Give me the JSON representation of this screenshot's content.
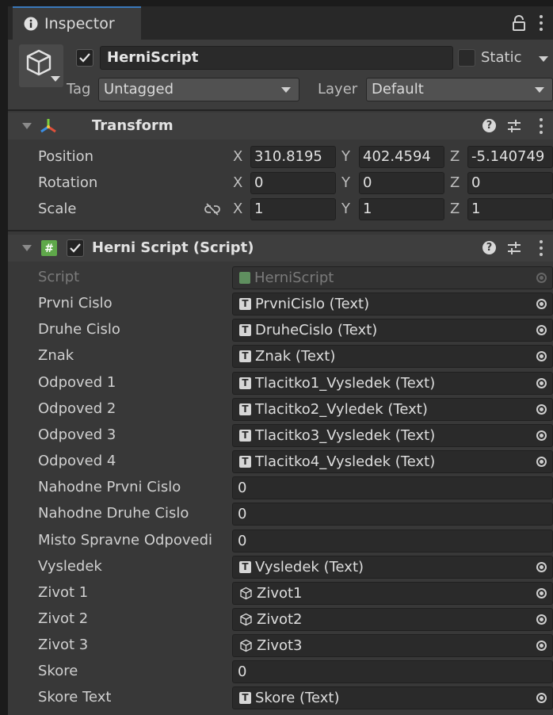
{
  "tab": {
    "label": "Inspector"
  },
  "header": {
    "object_name": "HerniScript",
    "static_label": "Static",
    "tag_label": "Tag",
    "tag_value": "Untagged",
    "layer_label": "Layer",
    "layer_value": "Default"
  },
  "transform": {
    "title": "Transform",
    "rows": [
      {
        "label": "Position",
        "x": "310.8195",
        "y": "402.4594",
        "z": "-5.140749"
      },
      {
        "label": "Rotation",
        "x": "0",
        "y": "0",
        "z": "0"
      },
      {
        "label": "Scale",
        "x": "1",
        "y": "1",
        "z": "1"
      }
    ],
    "axis": {
      "x": "X",
      "y": "Y",
      "z": "Z"
    }
  },
  "script_component": {
    "title": "Herni Script (Script)",
    "rows": [
      {
        "label": "Script",
        "value": "HerniScript",
        "icon": "script-icon",
        "kind": "object"
      },
      {
        "label": "Prvni Cislo",
        "value": "PrvniCislo (Text)",
        "icon": "text-icon",
        "kind": "object"
      },
      {
        "label": "Druhe Cislo",
        "value": "DruheCislo (Text)",
        "icon": "text-icon",
        "kind": "object"
      },
      {
        "label": "Znak",
        "value": "Znak (Text)",
        "icon": "text-icon",
        "kind": "object"
      },
      {
        "label": "Odpoved 1",
        "value": "Tlacitko1_Vysledek (Text)",
        "icon": "text-icon",
        "kind": "object"
      },
      {
        "label": "Odpoved 2",
        "value": "Tlacitko2_Vyledek (Text)",
        "icon": "text-icon",
        "kind": "object"
      },
      {
        "label": "Odpoved 3",
        "value": "Tlacitko3_Vysledek (Text)",
        "icon": "text-icon",
        "kind": "object"
      },
      {
        "label": "Odpoved 4",
        "value": "Tlacitko4_Vysledek (Text)",
        "icon": "text-icon",
        "kind": "object"
      },
      {
        "label": "Nahodne Prvni Cislo",
        "value": "0",
        "kind": "int"
      },
      {
        "label": "Nahodne Druhe Cislo",
        "value": "0",
        "kind": "int"
      },
      {
        "label": "Misto Spravne Odpovedi",
        "value": "0",
        "kind": "int"
      },
      {
        "label": "Vysledek",
        "value": "Vysledek (Text)",
        "icon": "text-icon",
        "kind": "object"
      },
      {
        "label": "Zivot 1",
        "value": "Zivot1",
        "icon": "gameobject-icon",
        "kind": "object"
      },
      {
        "label": "Zivot 2",
        "value": "Zivot2",
        "icon": "gameobject-icon",
        "kind": "object"
      },
      {
        "label": "Zivot 3",
        "value": "Zivot3",
        "icon": "gameobject-icon",
        "kind": "object"
      },
      {
        "label": "Skore",
        "value": "0",
        "kind": "int"
      },
      {
        "label": "Skore Text",
        "value": "Skore (Text)",
        "icon": "text-icon",
        "kind": "object"
      }
    ]
  },
  "icons": {
    "info": "info-icon",
    "lock": "lock-icon",
    "menu": "kebab-menu-icon",
    "gameobject": "cube-icon",
    "transform": "transform-axes-icon",
    "script": "csharp-script-icon",
    "help": "help-icon",
    "presets": "presets-icon",
    "link": "constrain-proportions-icon",
    "picker": "object-picker-icon"
  },
  "colors": {
    "panel": "#383838",
    "header": "#3c3c3c",
    "field": "#2a2a2a",
    "tab_accent": "#3a79bb",
    "text": "#d2d2d2"
  }
}
